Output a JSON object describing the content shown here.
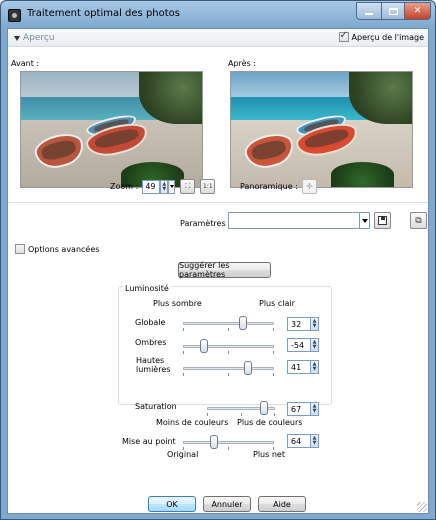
{
  "window": {
    "title": "Traitement optimal des photos"
  },
  "preview": {
    "section_label": "Aperçu",
    "show_preview_label": "Aperçu de l'image",
    "show_preview_checked": true,
    "before_label": "Avant :",
    "after_label": "Après :"
  },
  "zoom": {
    "label": "Zoom :",
    "value": "49",
    "pan_label": "Panoramique :"
  },
  "params": {
    "label": "Paramètres",
    "value": ""
  },
  "advanced": {
    "label": "Options avancées",
    "checked": false
  },
  "suggest_button": "Suggérer les paramètres",
  "luminosite": {
    "title": "Luminosité",
    "darker_label": "Plus sombre",
    "lighter_label": "Plus clair",
    "global": {
      "label": "Globale",
      "value": "32",
      "level": 0.66
    },
    "shadows": {
      "label": "Ombres",
      "value": "-54",
      "level": 0.23
    },
    "highlights": {
      "label": "Hautes lumières",
      "value": "41",
      "level": 0.71
    }
  },
  "saturation": {
    "label": "Saturation",
    "value": "67",
    "level": 0.84,
    "less_label": "Moins de couleurs",
    "more_label": "Plus de couleurs"
  },
  "sharpness": {
    "label": "Mise au point",
    "value": "64",
    "level": 0.34,
    "min_label": "Original",
    "max_label": "Plus net"
  },
  "buttons": {
    "ok": "OK",
    "cancel": "Annuler",
    "help": "Aide"
  },
  "icons": {
    "app": "camera-icon",
    "fit": "fit-to-window-icon",
    "actual": "actual-size-icon",
    "pan": "pan-crosshair-icon",
    "save": "save-disk-icon",
    "manage": "manage-presets-icon"
  }
}
